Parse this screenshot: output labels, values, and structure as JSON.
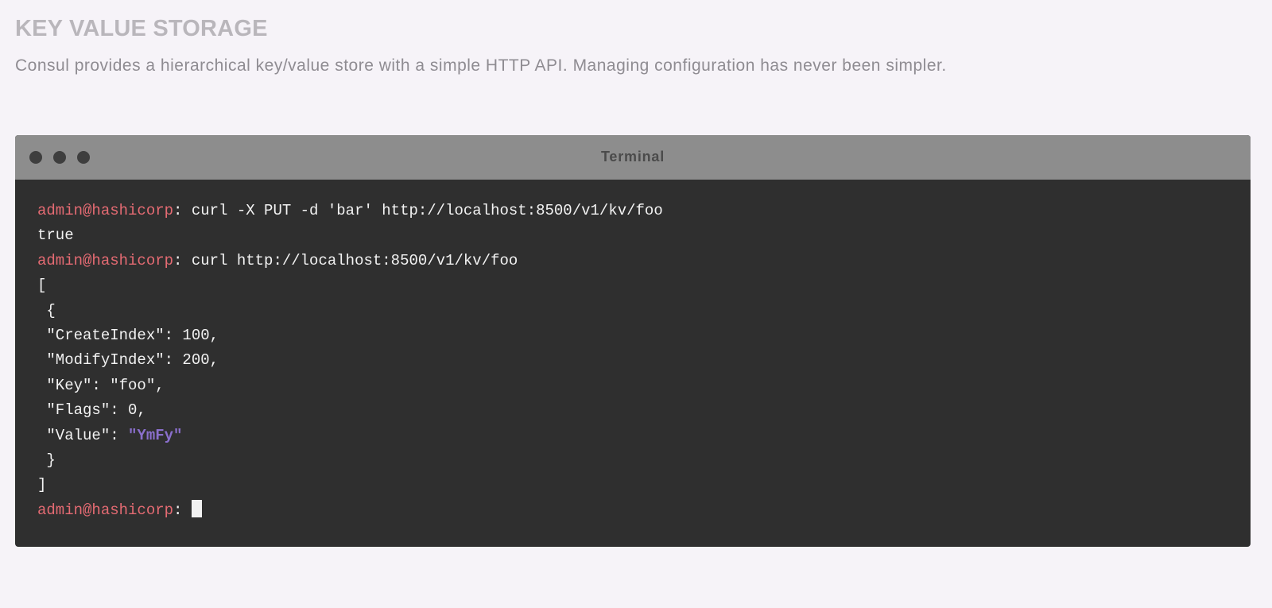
{
  "section": {
    "heading": "KEY VALUE STORAGE",
    "description": "Consul provides a hierarchical key/value store with a simple HTTP API. Managing configuration has never been simpler."
  },
  "terminal": {
    "title": "Terminal",
    "window_controls": [
      "close-dot",
      "minimize-dot",
      "maximize-dot"
    ],
    "prompt": "admin@hashicorp",
    "lines": {
      "cmd1": ": curl -X PUT -d 'bar' http://localhost:8500/v1/kv/foo",
      "out1": "true",
      "cmd2": ": curl http://localhost:8500/v1/kv/foo",
      "json_open": "[",
      "obj_open": " {",
      "create_index": " \"CreateIndex\": 100,",
      "modify_index": " \"ModifyIndex\": 200,",
      "key": " \"Key\": \"foo\",",
      "flags": " \"Flags\": 0,",
      "value_key": " \"Value\": ",
      "value_val": "\"YmFy\"",
      "obj_close": " }",
      "json_close": "]",
      "prompt_suffix": ": "
    }
  },
  "colors": {
    "page_background": "#f6f3f8",
    "heading": "#b9b6bb",
    "description": "#8f8c92",
    "titlebar": "#8d8d8d",
    "terminal_background": "#2f2f2f",
    "prompt": "#e56b73",
    "text": "#f2f2f2",
    "value_highlight": "#8a6fcc"
  }
}
